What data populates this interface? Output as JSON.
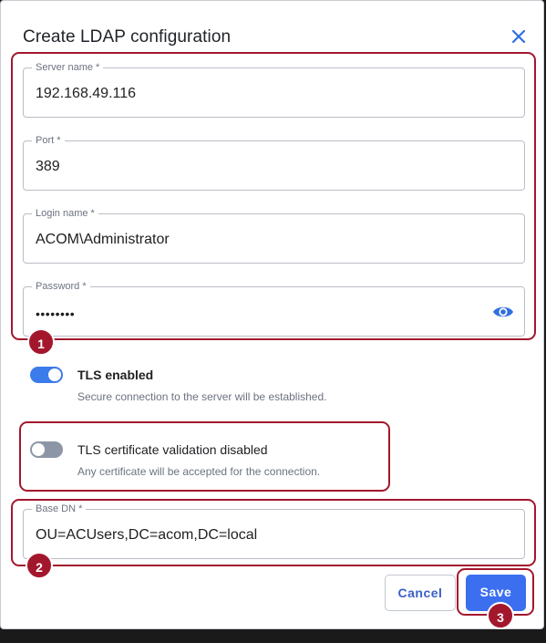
{
  "dialog": {
    "title": "Create LDAP configuration",
    "close_icon": "close-icon"
  },
  "fields": {
    "server_name": {
      "label": "Server name *",
      "value": "192.168.49.116"
    },
    "port": {
      "label": "Port *",
      "value": "389"
    },
    "login_name": {
      "label": "Login name *",
      "value": "ACOM\\Administrator"
    },
    "password": {
      "label": "Password *",
      "value": "••••••••",
      "toggle_icon": "eye-icon"
    },
    "base_dn": {
      "label": "Base DN *",
      "value": "OU=ACUsers,DC=acom,DC=local"
    }
  },
  "options": {
    "tls": {
      "title": "TLS enabled",
      "description": "Secure connection to the server will be established.",
      "enabled": true
    },
    "cert_validation": {
      "title": "TLS certificate validation disabled",
      "description": "Any certificate will be accepted for the connection.",
      "enabled": false
    }
  },
  "buttons": {
    "cancel": "Cancel",
    "save": "Save"
  },
  "annotations": {
    "badge_1": "1",
    "badge_2": "2",
    "badge_3": "3"
  },
  "colors": {
    "accent": "#3b6ff0",
    "annotation": "#a3172d",
    "toggle_on": "#3b7bea",
    "toggle_off": "#8d96a6"
  }
}
